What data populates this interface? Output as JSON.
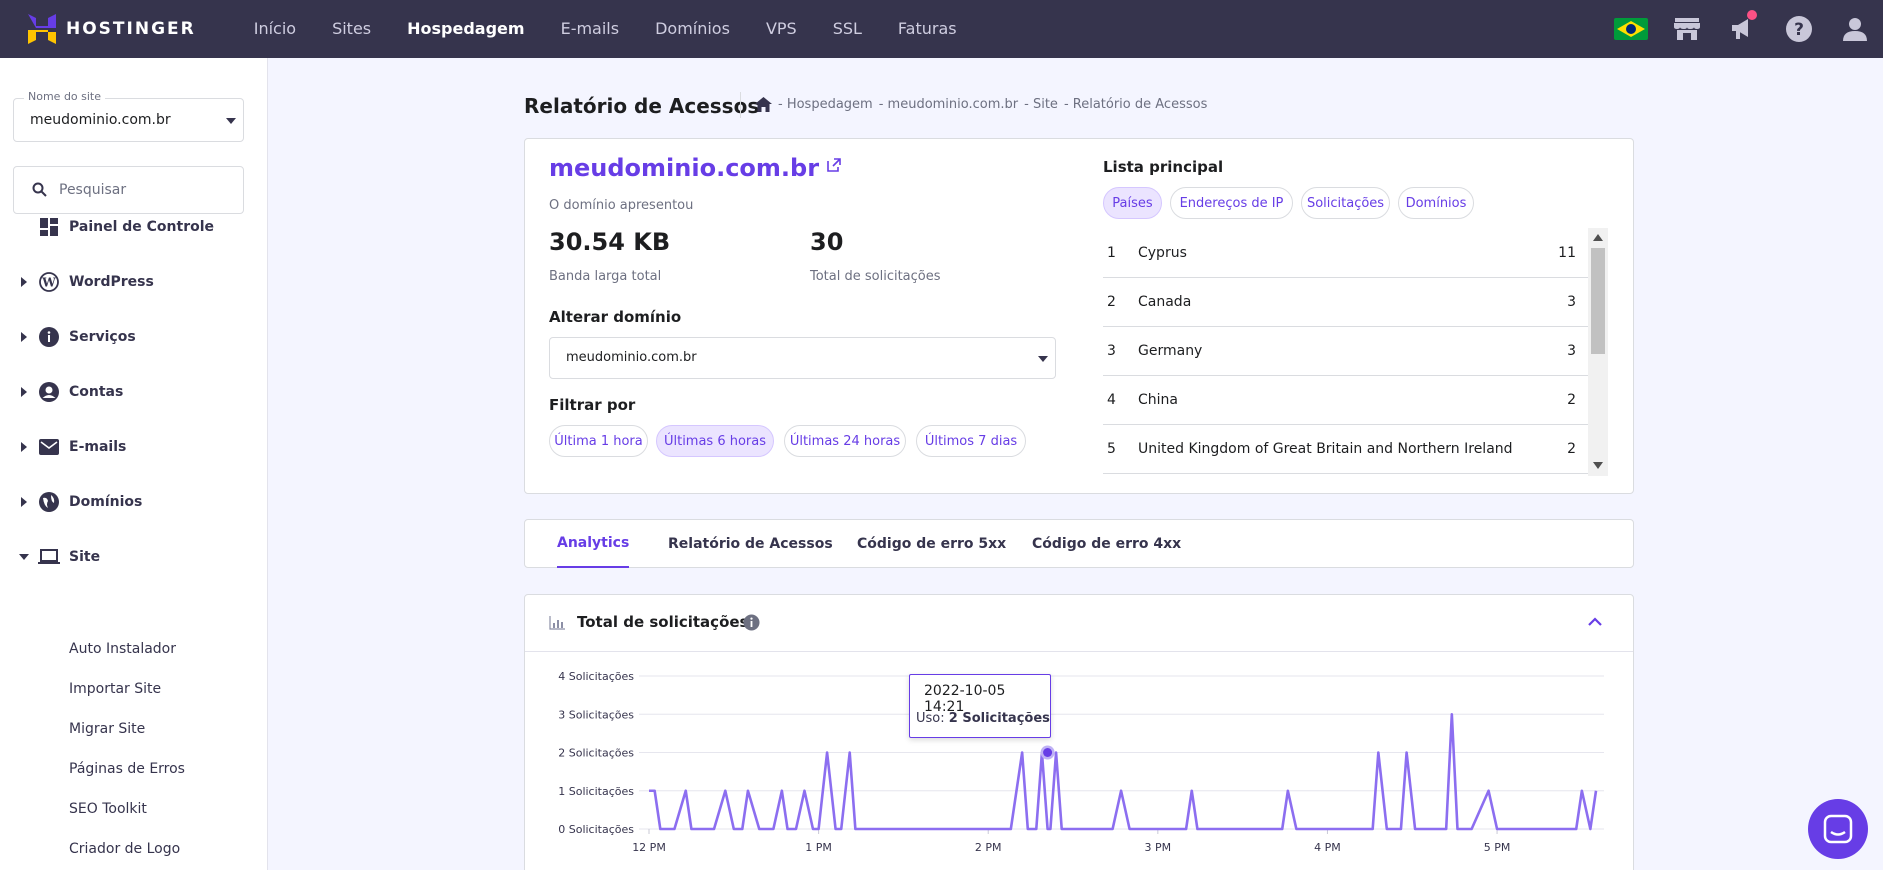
{
  "topbar": {
    "logo_text": "HOSTINGER",
    "nav": [
      "Início",
      "Sites",
      "Hospedagem",
      "E-mails",
      "Domínios",
      "VPS",
      "SSL",
      "Faturas"
    ],
    "active_nav": "Hospedagem"
  },
  "sidebar": {
    "site_select": {
      "label": "Nome do site",
      "value": "meudominio.com.br"
    },
    "search_placeholder": "Pesquisar",
    "items": [
      {
        "label": "Painel de Controle",
        "icon": "dashboard-icon",
        "expandable": false
      },
      {
        "label": "WordPress",
        "icon": "wordpress-icon",
        "expandable": true
      },
      {
        "label": "Serviços",
        "icon": "info-icon",
        "expandable": true
      },
      {
        "label": "Contas",
        "icon": "user-circle-icon",
        "expandable": true
      },
      {
        "label": "E-mails",
        "icon": "mail-icon",
        "expandable": true
      },
      {
        "label": "Domínios",
        "icon": "globe-icon",
        "expandable": true
      },
      {
        "label": "Site",
        "icon": "laptop-icon",
        "expandable": true,
        "expanded": true
      }
    ],
    "site_subitems": [
      "Auto Instalador",
      "Importar Site",
      "Migrar Site",
      "Páginas de Erros",
      "SEO Toolkit",
      "Criador de Logo"
    ]
  },
  "header": {
    "title": "Relatório de Acessos",
    "breadcrumb": [
      "- Hospedagem",
      "- meudominio.com.br",
      "- Site",
      "- Relatório de Acessos"
    ]
  },
  "summary": {
    "domain": "meudominio.com.br",
    "subtitle": "O domínio apresentou",
    "bandwidth_value": "30.54 KB",
    "bandwidth_label": "Banda larga total",
    "requests_value": "30",
    "requests_label": "Total de solicitações",
    "change_domain_label": "Alterar domínio",
    "change_domain_value": "meudominio.com.br",
    "filter_label": "Filtrar por",
    "filters": [
      "Última 1 hora",
      "Últimas 6 horas",
      "Últimas 24 horas",
      "Últimos 7 dias"
    ],
    "active_filter": "Últimas 6 horas"
  },
  "top_list": {
    "title": "Lista principal",
    "tabs": [
      "Países",
      "Endereços de IP",
      "Solicitações",
      "Domínios"
    ],
    "active_tab": "Países",
    "rows": [
      {
        "rank": "1",
        "name": "Cyprus",
        "count": "11"
      },
      {
        "rank": "2",
        "name": "Canada",
        "count": "3"
      },
      {
        "rank": "3",
        "name": "Germany",
        "count": "3"
      },
      {
        "rank": "4",
        "name": "China",
        "count": "2"
      },
      {
        "rank": "5",
        "name": "United Kingdom of Great Britain and Northern Ireland",
        "count": "2"
      }
    ]
  },
  "tabs": [
    "Analytics",
    "Relatório de Acessos",
    "Código de erro 5xx",
    "Código de erro 4xx"
  ],
  "active_tab": "Analytics",
  "chart_panel": {
    "title": "Total de solicitações"
  },
  "tooltip": {
    "date": "2022-10-05 14:21",
    "prefix": "Uso:",
    "value": "2 Solicitações"
  },
  "colors": {
    "accent": "#673de6",
    "topbar": "#36344d",
    "line": "#8c6ef0"
  },
  "chart_data": {
    "type": "line",
    "title": "Total de solicitações",
    "ylim": [
      0,
      4
    ],
    "y_ticks": [
      "0 Solicitações",
      "1 Solicitações",
      "2 Solicitações",
      "3 Solicitações",
      "4 Solicitações"
    ],
    "x_ticks": [
      "12 PM",
      "1 PM",
      "2 PM",
      "3 PM",
      "4 PM",
      "5 PM"
    ],
    "x_minutes_range": [
      0,
      335
    ],
    "series": [
      {
        "x": [
          0,
          2,
          4,
          9,
          13,
          15,
          19,
          23,
          27,
          30,
          33,
          35,
          39,
          44,
          47,
          49,
          52,
          55,
          58,
          60,
          63,
          66,
          68,
          71,
          73,
          76,
          78,
          82,
          87,
          89,
          91,
          94,
          96,
          99,
          128,
          132,
          134,
          137,
          139,
          141,
          142,
          144,
          146,
          150,
          153,
          155,
          164,
          167,
          170,
          190,
          192,
          194,
          224,
          226,
          229,
          256,
          258,
          261,
          266,
          268,
          271,
          282,
          284,
          286,
          287,
          289,
          291,
          297,
          300,
          302,
          308,
          310,
          313,
          323,
          325,
          328,
          330,
          333,
          335
        ],
        "y": [
          1,
          1,
          0,
          0,
          1,
          0,
          0,
          0,
          1,
          0,
          0,
          1,
          0,
          0,
          1,
          0,
          0,
          1,
          0,
          0,
          2,
          0,
          0,
          2,
          0,
          0,
          0,
          0,
          0,
          0,
          0,
          0,
          0,
          0,
          0,
          2,
          0,
          0,
          2,
          0,
          0,
          2,
          0,
          0,
          0,
          0,
          0,
          1,
          0,
          0,
          1,
          0,
          0,
          1,
          0,
          0,
          2,
          0,
          0,
          2,
          0,
          0,
          3,
          0,
          0,
          0,
          0,
          1,
          0,
          0,
          0,
          0,
          0,
          0,
          0,
          0,
          1,
          0,
          1
        ]
      }
    ]
  }
}
